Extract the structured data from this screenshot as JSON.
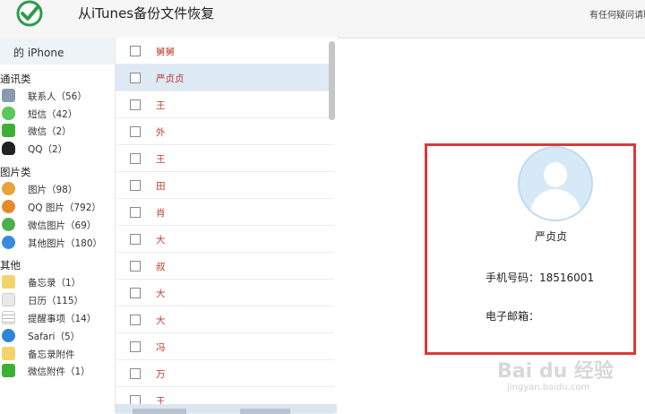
{
  "header": {
    "title": "从iTunes备份文件恢复",
    "help": "有任何疑问请联"
  },
  "sidebar": {
    "device": "的 iPhone",
    "sections": [
      {
        "title": "通讯类",
        "items": [
          {
            "label": "联系人（56）",
            "icon": "contacts-icon",
            "color": "#8a9bb0"
          },
          {
            "label": "短信（42）",
            "icon": "sms-icon",
            "color": "#5ac85a"
          },
          {
            "label": "微信（2）",
            "icon": "wechat-icon",
            "color": "#3cb034"
          },
          {
            "label": "QQ（2）",
            "icon": "qq-icon",
            "color": "#222222"
          }
        ]
      },
      {
        "title": "图片类",
        "items": [
          {
            "label": "图片（98）",
            "icon": "photos-icon",
            "color": "#e8a23a"
          },
          {
            "label": "QQ 图片（792）",
            "icon": "qq-photos-icon",
            "color": "#e58a2a"
          },
          {
            "label": "微信图片（69）",
            "icon": "wechat-photos-icon",
            "color": "#4cae4c"
          },
          {
            "label": "其他图片（180）",
            "icon": "other-photos-icon",
            "color": "#3a8be0"
          }
        ]
      },
      {
        "title": "其他",
        "items": [
          {
            "label": "备忘录（1）",
            "icon": "notes-icon",
            "color": "#f2d56a"
          },
          {
            "label": "日历（115）",
            "icon": "calendar-icon",
            "color": "#e9e9e9"
          },
          {
            "label": "提醒事项（14）",
            "icon": "reminders-icon",
            "color": "#c8c8c8"
          },
          {
            "label": "Safari（5）",
            "icon": "safari-icon",
            "color": "#2f84d6"
          },
          {
            "label": "备忘录附件",
            "icon": "notes-attachment-icon",
            "color": "#f2d56a"
          },
          {
            "label": "微信附件（1）",
            "icon": "wechat-attachment-icon",
            "color": "#3cb034"
          }
        ]
      }
    ]
  },
  "contacts": {
    "rows": [
      {
        "name": "舅舅",
        "selected": false
      },
      {
        "name": "严贞贞",
        "selected": true
      },
      {
        "name": "王",
        "selected": false
      },
      {
        "name": "外",
        "selected": false
      },
      {
        "name": "王",
        "selected": false
      },
      {
        "name": "田",
        "selected": false
      },
      {
        "name": "肖",
        "selected": false
      },
      {
        "name": "大",
        "selected": false
      },
      {
        "name": "叔",
        "selected": false
      },
      {
        "name": "大",
        "selected": false
      },
      {
        "name": "大",
        "selected": false
      },
      {
        "name": "冯",
        "selected": false
      },
      {
        "name": "万",
        "selected": false
      },
      {
        "name": "王",
        "selected": false
      }
    ]
  },
  "detail": {
    "name": "严贞贞",
    "phone": "手机号码：18516001",
    "email": "电子邮箱："
  },
  "watermark": {
    "brand": "Bai du 经验",
    "url": "jingyan.baidu.com"
  },
  "colors": {
    "accent_red": "#d63b3b",
    "name_red": "#c0392b",
    "selected_row": "#dde9f4"
  }
}
